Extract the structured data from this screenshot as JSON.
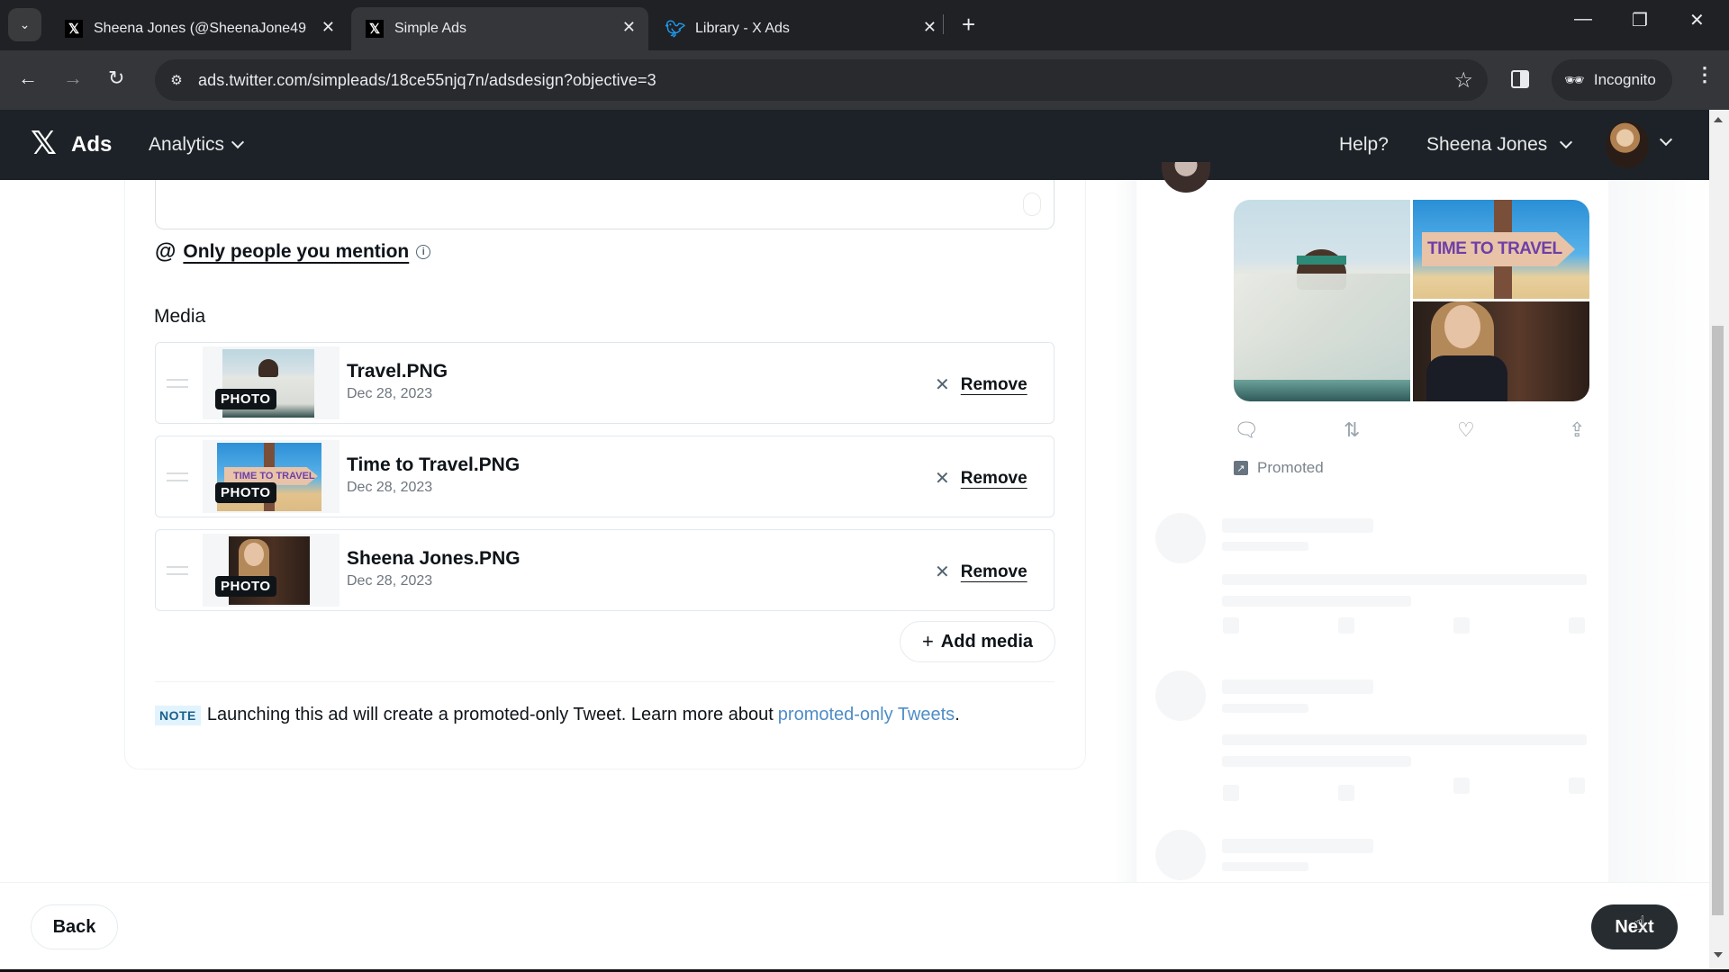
{
  "browser": {
    "tabs": [
      {
        "title": "Sheena Jones (@SheenaJone49",
        "favicon": "x-logo-icon",
        "active": false
      },
      {
        "title": "Simple Ads",
        "favicon": "x-logo-icon",
        "active": true
      },
      {
        "title": "Library - X Ads",
        "favicon": "twitter-bird-icon",
        "active": false
      }
    ],
    "url": "ads.twitter.com/simpleads/18ce55njq7n/adsdesign?objective=3",
    "incognito_label": "Incognito"
  },
  "app_header": {
    "logo_text": "Ads",
    "nav_analytics": "Analytics",
    "help": "Help?",
    "user_name": "Sheena Jones"
  },
  "composer": {
    "reply_setting_label": "Only people you mention",
    "media_heading": "Media",
    "media_items": [
      {
        "name": "Travel.PNG",
        "date": "Dec 28, 2023",
        "badge": "PHOTO",
        "remove_label": "Remove"
      },
      {
        "name": "Time to Travel.PNG",
        "date": "Dec 28, 2023",
        "badge": "PHOTO",
        "remove_label": "Remove"
      },
      {
        "name": "Sheena Jones.PNG",
        "date": "Dec 28, 2023",
        "badge": "PHOTO",
        "remove_label": "Remove"
      }
    ],
    "add_media_label": "Add media",
    "note_badge": "NOTE",
    "note_text": "Launching this ad will create a promoted-only Tweet. Learn more about",
    "note_link": "promoted-only Tweets",
    "note_end": "."
  },
  "preview": {
    "sign_text": "TIME TO TRAVEL",
    "promoted_label": "Promoted"
  },
  "footer": {
    "back_label": "Back",
    "next_label": "Next"
  },
  "colors": {
    "header_bg": "#1c2227",
    "primary_button": "#272c30",
    "link": "#4f8dc7",
    "note_badge_bg": "#e1f3fd"
  }
}
